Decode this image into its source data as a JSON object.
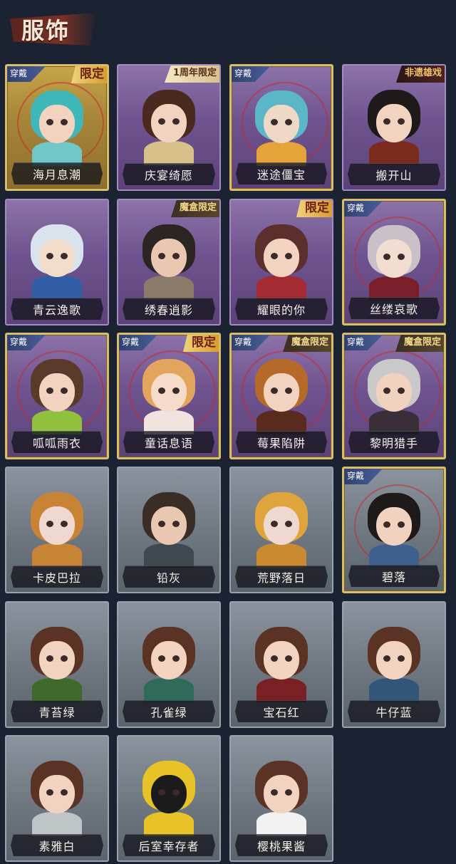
{
  "header": {
    "title": "服饰"
  },
  "colors": {
    "background": "#1b2231",
    "accent_worn": "#d8bd6b",
    "badge_red": "#6b1e14"
  },
  "items": [
    {
      "name": "海月息潮",
      "rarity": "gold",
      "worn_label": "穿戴",
      "badge": "限定",
      "badge_style": "limited",
      "skin": "#f2d3bf",
      "hair": "#3fb6b8",
      "outfit": "#6fc7c7"
    },
    {
      "name": "庆宴绮愿",
      "rarity": "purple",
      "worn_label": "",
      "badge": "1周年限定",
      "badge_style": "anniv",
      "skin": "#f2d3bf",
      "hair": "#4a2a1e",
      "outfit": "#d8c08a"
    },
    {
      "name": "迷途僵宝",
      "rarity": "purple",
      "worn_label": "穿戴",
      "badge": "",
      "badge_style": "",
      "skin": "#f0d8c6",
      "hair": "#5bb6c7",
      "outfit": "#e7a33b"
    },
    {
      "name": "搬开山",
      "rarity": "purple",
      "worn_label": "",
      "badge": "非遗雄戏",
      "badge_style": "feiyi",
      "skin": "#f2d3bf",
      "hair": "#1f1a1a",
      "outfit": "#7b2a1e"
    },
    {
      "name": "青云逸歌",
      "rarity": "purple",
      "worn_label": "",
      "badge": "",
      "badge_style": "",
      "skin": "#f4dccb",
      "hair": "#d9e3ee",
      "outfit": "#2f5ea7"
    },
    {
      "name": "绣春逍影",
      "rarity": "purple",
      "worn_label": "",
      "badge": "魔盒限定",
      "badge_style": "mohe",
      "skin": "#e9c7b1",
      "hair": "#2b2523",
      "outfit": "#8b7b6a"
    },
    {
      "name": "耀眼的你",
      "rarity": "purple",
      "worn_label": "",
      "badge": "限定",
      "badge_style": "limited",
      "skin": "#f2d3bf",
      "hair": "#5a2f2c",
      "outfit": "#a52b33"
    },
    {
      "name": "丝缕哀歌",
      "rarity": "purple",
      "worn_label": "穿戴",
      "badge": "",
      "badge_style": "",
      "skin": "#f3ddd0",
      "hair": "#c9c1c7",
      "outfit": "#7a1f2a"
    },
    {
      "name": "呱呱雨衣",
      "rarity": "purple",
      "worn_label": "穿戴",
      "badge": "",
      "badge_style": "",
      "skin": "#f2d3bf",
      "hair": "#5a3a2a",
      "outfit": "#8fc13e"
    },
    {
      "name": "童话息语",
      "rarity": "purple",
      "worn_label": "穿戴",
      "badge": "限定",
      "badge_style": "limited",
      "skin": "#f6dcc8",
      "hair": "#e3a45e",
      "outfit": "#f1e4e0"
    },
    {
      "name": "莓果陷阱",
      "rarity": "purple",
      "worn_label": "穿戴",
      "badge": "魔盒限定",
      "badge_style": "mohe",
      "skin": "#f2d3bf",
      "hair": "#b66a2a",
      "outfit": "#5a2a1f"
    },
    {
      "name": "黎明猎手",
      "rarity": "purple",
      "worn_label": "穿戴",
      "badge": "魔盒限定",
      "badge_style": "mohe",
      "skin": "#f0d2be",
      "hair": "#c9c9c9",
      "outfit": "#3a2f38"
    },
    {
      "name": "卡皮巴拉",
      "rarity": "gray",
      "worn_label": "",
      "badge": "",
      "badge_style": "",
      "skin": "#efd8d0",
      "hair": "#c88434",
      "outfit": "#c88434"
    },
    {
      "name": "铅灰",
      "rarity": "gray",
      "worn_label": "",
      "badge": "",
      "badge_style": "",
      "skin": "#e9c7b1",
      "hair": "#3a2d25",
      "outfit": "#3f474f"
    },
    {
      "name": "荒野落日",
      "rarity": "gray",
      "worn_label": "",
      "badge": "",
      "badge_style": "",
      "skin": "#efd8d0",
      "hair": "#e0a43c",
      "outfit": "#c98a30"
    },
    {
      "name": "碧落",
      "rarity": "gray",
      "worn_label": "穿戴",
      "badge": "",
      "badge_style": "",
      "skin": "#f0d2be",
      "hair": "#1f1a1a",
      "outfit": "#3f5f8f"
    },
    {
      "name": "青苔绿",
      "rarity": "gray",
      "worn_label": "",
      "badge": "",
      "badge_style": "",
      "skin": "#f2d3bf",
      "hair": "#5a3324",
      "outfit": "#3f6a2a"
    },
    {
      "name": "孔雀绿",
      "rarity": "gray",
      "worn_label": "",
      "badge": "",
      "badge_style": "",
      "skin": "#f2d3bf",
      "hair": "#5a3324",
      "outfit": "#2f6a5a"
    },
    {
      "name": "宝石红",
      "rarity": "gray",
      "worn_label": "",
      "badge": "",
      "badge_style": "",
      "skin": "#f2d3bf",
      "hair": "#5a3324",
      "outfit": "#7a1f24"
    },
    {
      "name": "牛仔蓝",
      "rarity": "gray",
      "worn_label": "",
      "badge": "",
      "badge_style": "",
      "skin": "#f2d3bf",
      "hair": "#5a3324",
      "outfit": "#34557a"
    },
    {
      "name": "素雅白",
      "rarity": "gray",
      "worn_label": "",
      "badge": "",
      "badge_style": "",
      "skin": "#f2d3bf",
      "hair": "#5a3324",
      "outfit": "#bfc4c7"
    },
    {
      "name": "后室幸存者",
      "rarity": "gray",
      "worn_label": "",
      "badge": "",
      "badge_style": "",
      "skin": "#1b1b1b",
      "hair": "#e8c327",
      "outfit": "#e8c327"
    },
    {
      "name": "樱桃果酱",
      "rarity": "gray",
      "worn_label": "",
      "badge": "",
      "badge_style": "",
      "skin": "#f2d3bf",
      "hair": "#5a3324",
      "outfit": "#f1f1f1"
    }
  ]
}
